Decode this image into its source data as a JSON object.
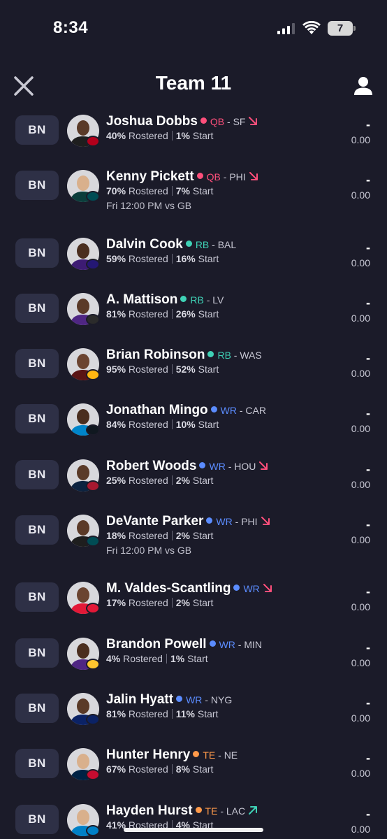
{
  "status": {
    "time": "8:34",
    "battery": "7"
  },
  "header": {
    "title": "Team 11"
  },
  "colors": {
    "qb": "#ff4f7b",
    "rb": "#3fd2b6",
    "wr": "#5b8cff",
    "te": "#ff9a4a",
    "trend_down": "#ff4f7b",
    "trend_up": "#3fd2b6"
  },
  "players": [
    {
      "slot": "BN",
      "name": "Joshua Dobbs",
      "pos": "QB",
      "team": "- SF",
      "trend": "down",
      "rostered_pct": "40%",
      "rostered_label": "Rostered",
      "start_pct": "1%",
      "start_label": "Start",
      "game": "",
      "proj": "-",
      "points": "0.00"
    },
    {
      "slot": "BN",
      "name": "Kenny Pickett",
      "pos": "QB",
      "team": "- PHI",
      "trend": "down",
      "rostered_pct": "70%",
      "rostered_label": "Rostered",
      "start_pct": "7%",
      "start_label": "Start",
      "game": "Fri 12:00 PM vs GB",
      "proj": "-",
      "points": "0.00"
    },
    {
      "slot": "BN",
      "name": "Dalvin Cook",
      "pos": "RB",
      "team": "- BAL",
      "trend": "",
      "rostered_pct": "59%",
      "rostered_label": "Rostered",
      "start_pct": "16%",
      "start_label": "Start",
      "game": "",
      "proj": "-",
      "points": "0.00"
    },
    {
      "slot": "BN",
      "name": "A. Mattison",
      "pos": "RB",
      "team": "- LV",
      "trend": "",
      "rostered_pct": "81%",
      "rostered_label": "Rostered",
      "start_pct": "26%",
      "start_label": "Start",
      "game": "",
      "proj": "-",
      "points": "0.00"
    },
    {
      "slot": "BN",
      "name": "Brian Robinson",
      "pos": "RB",
      "team": "- WAS",
      "trend": "",
      "rostered_pct": "95%",
      "rostered_label": "Rostered",
      "start_pct": "52%",
      "start_label": "Start",
      "game": "",
      "proj": "-",
      "points": "0.00"
    },
    {
      "slot": "BN",
      "name": "Jonathan Mingo",
      "pos": "WR",
      "team": "- CAR",
      "trend": "",
      "rostered_pct": "84%",
      "rostered_label": "Rostered",
      "start_pct": "10%",
      "start_label": "Start",
      "game": "",
      "proj": "-",
      "points": "0.00"
    },
    {
      "slot": "BN",
      "name": "Robert Woods",
      "pos": "WR",
      "team": "- HOU",
      "trend": "down",
      "rostered_pct": "25%",
      "rostered_label": "Rostered",
      "start_pct": "2%",
      "start_label": "Start",
      "game": "",
      "proj": "-",
      "points": "0.00"
    },
    {
      "slot": "BN",
      "name": "DeVante Parker",
      "pos": "WR",
      "team": "- PHI",
      "trend": "down",
      "rostered_pct": "18%",
      "rostered_label": "Rostered",
      "start_pct": "2%",
      "start_label": "Start",
      "game": "Fri 12:00 PM vs GB",
      "proj": "-",
      "points": "0.00"
    },
    {
      "slot": "BN",
      "name": "M. Valdes-Scantling",
      "pos": "WR",
      "team": "",
      "trend": "down",
      "rostered_pct": "17%",
      "rostered_label": "Rostered",
      "start_pct": "2%",
      "start_label": "Start",
      "game": "",
      "proj": "-",
      "points": "0.00"
    },
    {
      "slot": "BN",
      "name": "Brandon Powell",
      "pos": "WR",
      "team": "- MIN",
      "trend": "",
      "rostered_pct": "4%",
      "rostered_label": "Rostered",
      "start_pct": "1%",
      "start_label": "Start",
      "game": "",
      "proj": "-",
      "points": "0.00"
    },
    {
      "slot": "BN",
      "name": "Jalin Hyatt",
      "pos": "WR",
      "team": "- NYG",
      "trend": "",
      "rostered_pct": "81%",
      "rostered_label": "Rostered",
      "start_pct": "11%",
      "start_label": "Start",
      "game": "",
      "proj": "-",
      "points": "0.00"
    },
    {
      "slot": "BN",
      "name": "Hunter Henry",
      "pos": "TE",
      "team": "- NE",
      "trend": "",
      "rostered_pct": "67%",
      "rostered_label": "Rostered",
      "start_pct": "8%",
      "start_label": "Start",
      "game": "",
      "proj": "-",
      "points": "0.00"
    },
    {
      "slot": "BN",
      "name": "Hayden Hurst",
      "pos": "TE",
      "team": "- LAC",
      "trend": "up",
      "rostered_pct": "41%",
      "rostered_label": "Rostered",
      "start_pct": "4%",
      "start_label": "Start",
      "game": "",
      "proj": "-",
      "points": "0.00"
    }
  ]
}
